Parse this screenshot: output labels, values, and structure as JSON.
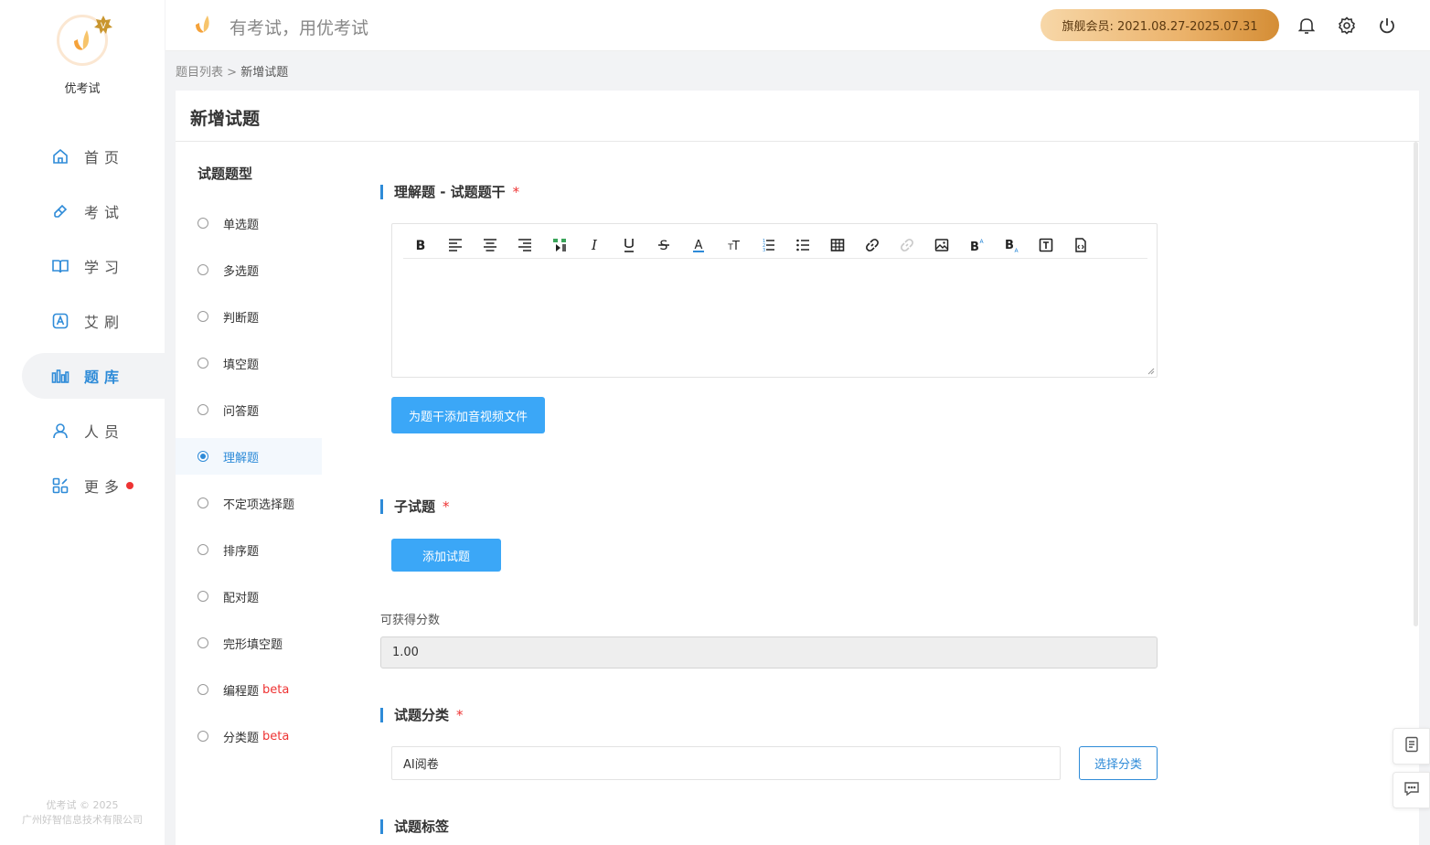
{
  "app": {
    "name": "优考试",
    "slogan": "有考试，用优考试"
  },
  "membership": {
    "text": "旗舰会员: 2021.08.27-2025.07.31"
  },
  "sidebar": {
    "items": [
      {
        "label": "首页",
        "icon": "home-icon"
      },
      {
        "label": "考试",
        "icon": "eraser-icon"
      },
      {
        "label": "学习",
        "icon": "book-icon"
      },
      {
        "label": "艾刷",
        "icon": "a-badge-icon"
      },
      {
        "label": "题库",
        "icon": "bars-icon",
        "active": true
      },
      {
        "label": "人员",
        "icon": "user-icon"
      },
      {
        "label": "更多",
        "icon": "apps-icon",
        "has_dot": true
      }
    ],
    "footer_line1": "优考试 © 2025",
    "footer_line2": "广州好智信息技术有限公司"
  },
  "breadcrumb": {
    "parent": "题目列表",
    "separator": ">",
    "current": "新增试题"
  },
  "page": {
    "title": "新增试题"
  },
  "question_types": {
    "title": "试题题型",
    "items": [
      {
        "label": "单选题",
        "beta": ""
      },
      {
        "label": "多选题",
        "beta": ""
      },
      {
        "label": "判断题",
        "beta": ""
      },
      {
        "label": "填空题",
        "beta": ""
      },
      {
        "label": "问答题",
        "beta": ""
      },
      {
        "label": "理解题",
        "beta": "",
        "selected": true
      },
      {
        "label": "不定项选择题",
        "beta": ""
      },
      {
        "label": "排序题",
        "beta": ""
      },
      {
        "label": "配对题",
        "beta": ""
      },
      {
        "label": "完形填空题",
        "beta": ""
      },
      {
        "label": "编程题",
        "beta": "beta"
      },
      {
        "label": "分类题",
        "beta": "beta"
      }
    ]
  },
  "stem": {
    "title": "理解题 - 试题题干",
    "required": "*",
    "toolbar": [
      "bold",
      "align-left",
      "align-center",
      "align-right",
      "format-painter",
      "italic",
      "underline",
      "strikethrough",
      "font-color",
      "font-size",
      "ordered-list",
      "unordered-list",
      "table",
      "link",
      "unlink",
      "image",
      "superscript",
      "subscript",
      "textbox",
      "html-source"
    ],
    "add_media_button": "为题干添加音视频文件"
  },
  "sub_questions": {
    "title": "子试题",
    "required": "*",
    "add_button": "添加试题"
  },
  "score": {
    "label": "可获得分数",
    "value": "1.00"
  },
  "category": {
    "title": "试题分类",
    "required": "*",
    "value": "AI阅卷",
    "select_button": "选择分类"
  },
  "tags": {
    "title": "试题标签"
  },
  "colors": {
    "accent": "#2e8bd8",
    "button": "#3ba7f7",
    "required": "#ee3333",
    "member_gold": "#ebb26a"
  }
}
